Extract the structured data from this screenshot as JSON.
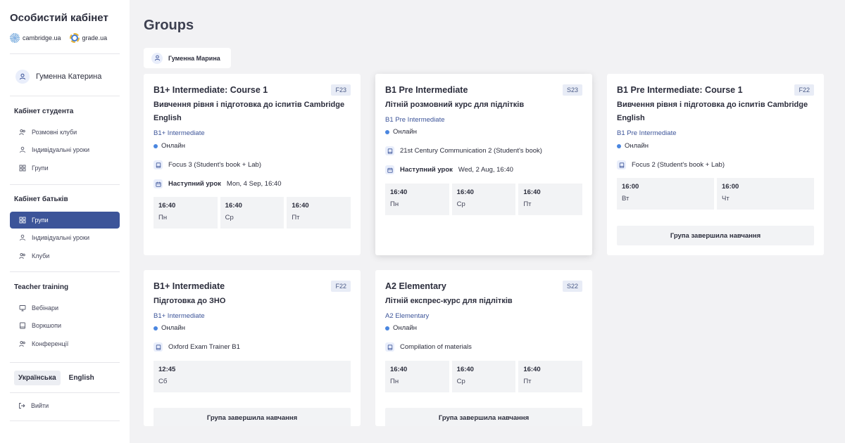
{
  "sidebar": {
    "app_title": "Особистий кабінет",
    "brands": [
      "cambridge.ua",
      "grade.ua"
    ],
    "user_name": "Гуменна Катерина",
    "student_section": {
      "title": "Кабінет студента",
      "items": [
        "Розмовні клуби",
        "Індивідуальні уроки",
        "Групи"
      ]
    },
    "parent_section": {
      "title": "Кабінет батьків",
      "items": [
        "Групи",
        "Індивідуальні уроки",
        "Клуби"
      ]
    },
    "teacher_section": {
      "title": "Teacher training",
      "items": [
        "Вебінари",
        "Воркшопи",
        "Конференції"
      ]
    },
    "languages": [
      "Українська",
      "English"
    ],
    "active_language": "Українська",
    "logout": "Вийти"
  },
  "main": {
    "title": "Groups",
    "child_name": "Гуменна Марина",
    "next_lesson_label": "Наступний урок",
    "finished_label": "Група завершила навчання",
    "cards": [
      {
        "course": "B1+ Intermediate: Course 1",
        "season": "F23",
        "subtitle": "Вивчення рівня і підготовка до іспитів Cambridge English",
        "level": "B1+ Intermediate",
        "format": "Онлайн",
        "book": "Focus 3 (Student's book + Lab)",
        "next_lesson": "Mon, 4 Sep, 16:40",
        "slots": [
          {
            "time": "16:40",
            "day": "Пн"
          },
          {
            "time": "16:40",
            "day": "Ср"
          },
          {
            "time": "16:40",
            "day": "Пт"
          }
        ]
      },
      {
        "course": "B1 Pre Intermediate",
        "season": "S23",
        "subtitle": "Літній розмовний курс для підлітків",
        "level": "B1 Pre Intermediate",
        "format": "Онлайн",
        "book": "21st Century Communication 2 (Student's book)",
        "next_lesson": "Wed, 2 Aug, 16:40",
        "slots": [
          {
            "time": "16:40",
            "day": "Пн"
          },
          {
            "time": "16:40",
            "day": "Ср"
          },
          {
            "time": "16:40",
            "day": "Пт"
          }
        ]
      },
      {
        "course": "B1 Pre Intermediate: Course 1",
        "season": "F22",
        "subtitle": "Вивчення рівня і підготовка до іспитів Cambridge English",
        "level": "B1 Pre Intermediate",
        "format": "Онлайн",
        "book": "Focus 2 (Student's book + Lab)",
        "slots": [
          {
            "time": "16:00",
            "day": "Вт"
          },
          {
            "time": "16:00",
            "day": "Чт"
          }
        ]
      },
      {
        "course": "B1+ Intermediate",
        "season": "F22",
        "subtitle": "Підготовка до ЗНО",
        "level": "B1+ Intermediate",
        "format": "Онлайн",
        "book": "Oxford Exam Trainer B1",
        "slots": [
          {
            "time": "12:45",
            "day": "Сб"
          }
        ]
      },
      {
        "course": "A2 Elementary",
        "season": "S22",
        "subtitle": "Літній експрес-курс для підлітків",
        "level": "A2 Elementary",
        "format": "Онлайн",
        "book": "Compilation of materials",
        "slots": [
          {
            "time": "16:40",
            "day": "Пн"
          },
          {
            "time": "16:40",
            "day": "Ср"
          },
          {
            "time": "16:40",
            "day": "Пт"
          }
        ]
      }
    ]
  }
}
